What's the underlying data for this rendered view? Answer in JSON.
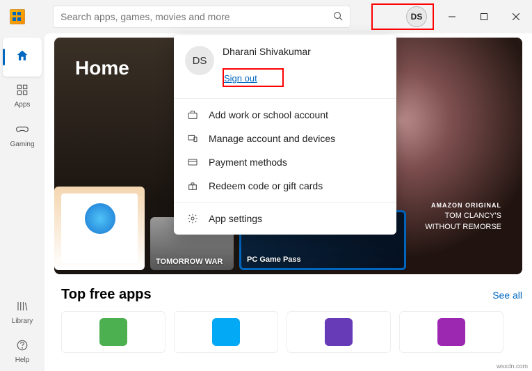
{
  "search": {
    "placeholder": "Search apps, games, movies and more"
  },
  "profile": {
    "initials": "DS"
  },
  "sidebar": {
    "home": "",
    "apps": "Apps",
    "gaming": "Gaming",
    "library": "Library",
    "help": "Help"
  },
  "hero": {
    "title": "Home",
    "franchise_prefix": "AMAZON ORIGINAL",
    "franchise_line1": "TOM CLANCY'S",
    "franchise_line2": "WITHOUT REMORSE",
    "thumbs": {
      "app_caption": "",
      "tomorrow_caption": "TOMORROW WAR",
      "pc_game_pass": "PC Game Pass"
    }
  },
  "section": {
    "title": "Top free apps",
    "see_all": "See all"
  },
  "dropdown": {
    "initials": "DS",
    "name": "Dharani Shivakumar",
    "signout": "Sign out",
    "items": [
      "Add work or school account",
      "Manage account and devices",
      "Payment methods",
      "Redeem code or gift cards",
      "App settings"
    ]
  },
  "footer": "wsxdn.com"
}
